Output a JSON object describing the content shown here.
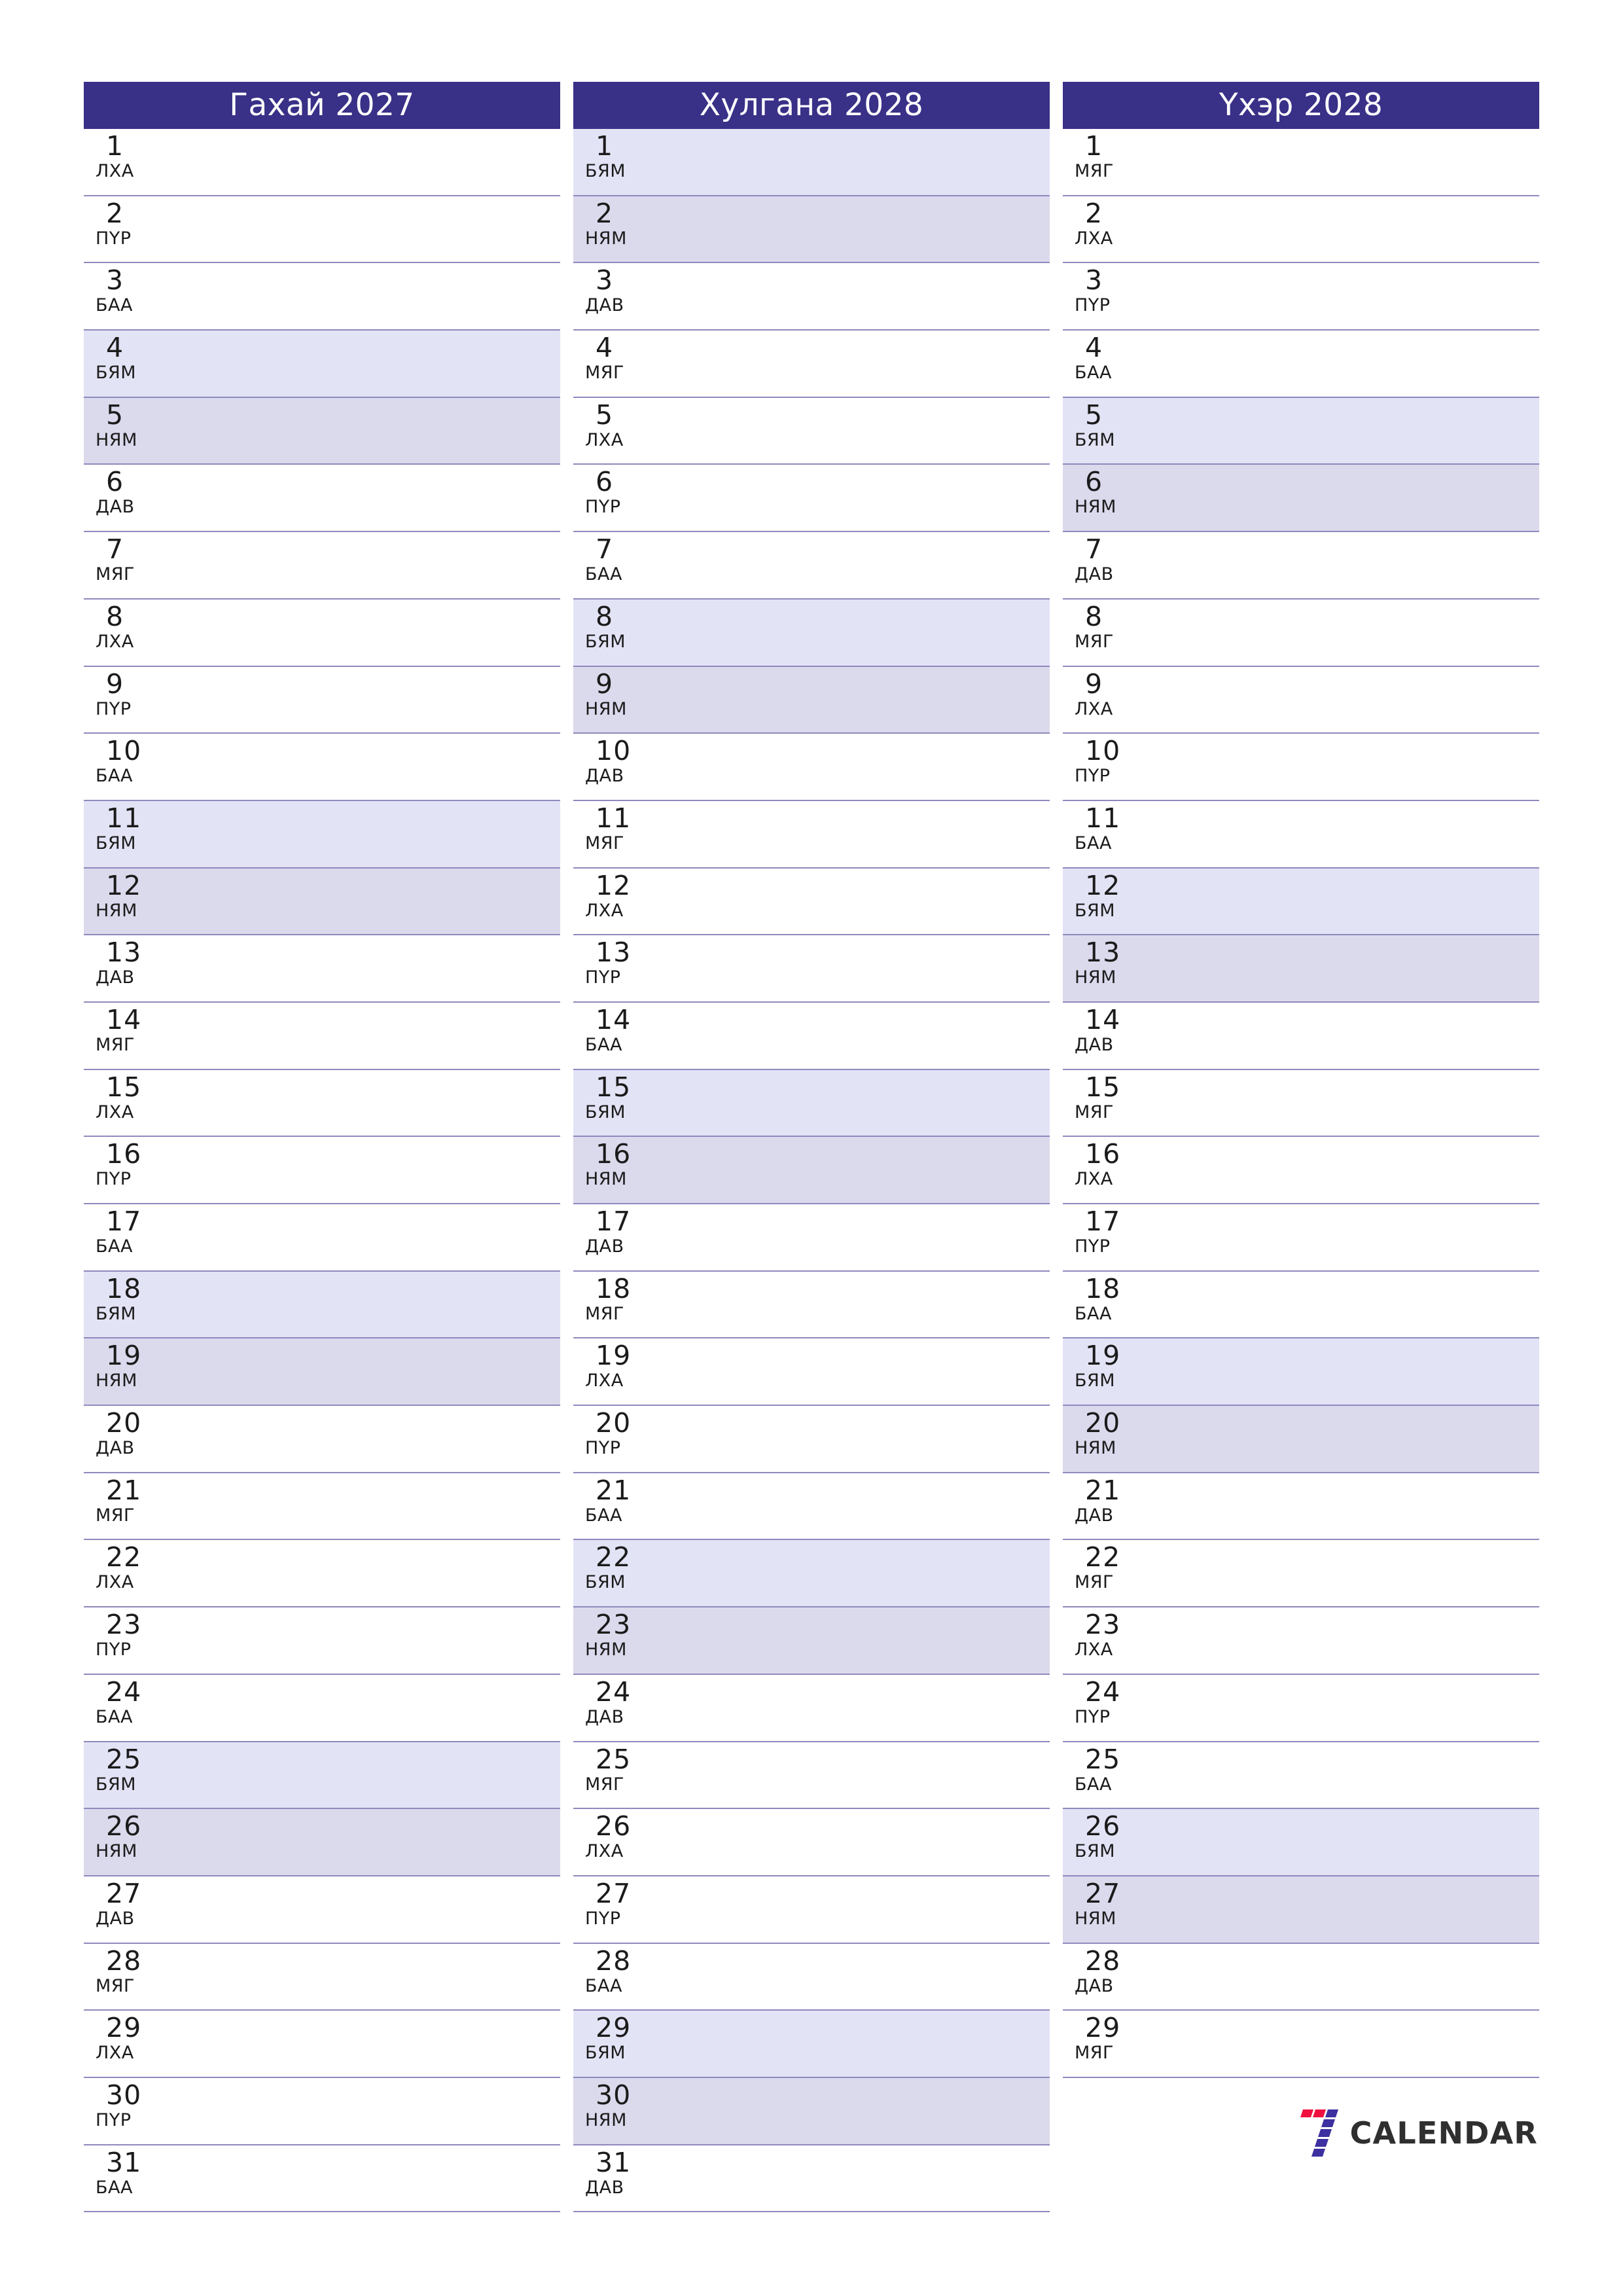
{
  "theme": {
    "header_bg": "#393087",
    "header_text": "#ffffff",
    "saturday_bg": "#e3e3f6",
    "sunday_bg": "#dbd9ec",
    "row_divider": "#8e89bd",
    "page_bg": "#ffffff",
    "day_text": "#1b1b1b",
    "logo_red": "#f0103f",
    "logo_purple": "#3d30a0",
    "logo_text": "#2f2f2f"
  },
  "brand": {
    "mark": "seven-logo-icon",
    "name": "CALENDAR"
  },
  "weekday_abbr": {
    "mon": "ДАВ",
    "tue": "МЯГ",
    "wed": "ЛХА",
    "thu": "ПҮР",
    "fri": "БАА",
    "sat": "БЯМ",
    "sun": "НЯМ"
  },
  "months": [
    {
      "title": "Гахай 2027",
      "days": [
        {
          "n": "1",
          "w": "ЛХА",
          "t": "wd"
        },
        {
          "n": "2",
          "w": "ПҮР",
          "t": "wd"
        },
        {
          "n": "3",
          "w": "БАА",
          "t": "wd"
        },
        {
          "n": "4",
          "w": "БЯМ",
          "t": "sat"
        },
        {
          "n": "5",
          "w": "НЯМ",
          "t": "sun"
        },
        {
          "n": "6",
          "w": "ДАВ",
          "t": "wd"
        },
        {
          "n": "7",
          "w": "МЯГ",
          "t": "wd"
        },
        {
          "n": "8",
          "w": "ЛХА",
          "t": "wd"
        },
        {
          "n": "9",
          "w": "ПҮР",
          "t": "wd"
        },
        {
          "n": "10",
          "w": "БАА",
          "t": "wd"
        },
        {
          "n": "11",
          "w": "БЯМ",
          "t": "sat"
        },
        {
          "n": "12",
          "w": "НЯМ",
          "t": "sun"
        },
        {
          "n": "13",
          "w": "ДАВ",
          "t": "wd"
        },
        {
          "n": "14",
          "w": "МЯГ",
          "t": "wd"
        },
        {
          "n": "15",
          "w": "ЛХА",
          "t": "wd"
        },
        {
          "n": "16",
          "w": "ПҮР",
          "t": "wd"
        },
        {
          "n": "17",
          "w": "БАА",
          "t": "wd"
        },
        {
          "n": "18",
          "w": "БЯМ",
          "t": "sat"
        },
        {
          "n": "19",
          "w": "НЯМ",
          "t": "sun"
        },
        {
          "n": "20",
          "w": "ДАВ",
          "t": "wd"
        },
        {
          "n": "21",
          "w": "МЯГ",
          "t": "wd"
        },
        {
          "n": "22",
          "w": "ЛХА",
          "t": "wd"
        },
        {
          "n": "23",
          "w": "ПҮР",
          "t": "wd"
        },
        {
          "n": "24",
          "w": "БАА",
          "t": "wd"
        },
        {
          "n": "25",
          "w": "БЯМ",
          "t": "sat"
        },
        {
          "n": "26",
          "w": "НЯМ",
          "t": "sun"
        },
        {
          "n": "27",
          "w": "ДАВ",
          "t": "wd"
        },
        {
          "n": "28",
          "w": "МЯГ",
          "t": "wd"
        },
        {
          "n": "29",
          "w": "ЛХА",
          "t": "wd"
        },
        {
          "n": "30",
          "w": "ПҮР",
          "t": "wd"
        },
        {
          "n": "31",
          "w": "БАА",
          "t": "wd"
        }
      ],
      "has_logo": false
    },
    {
      "title": "Хулгана 2028",
      "days": [
        {
          "n": "1",
          "w": "БЯМ",
          "t": "sat"
        },
        {
          "n": "2",
          "w": "НЯМ",
          "t": "sun"
        },
        {
          "n": "3",
          "w": "ДАВ",
          "t": "wd"
        },
        {
          "n": "4",
          "w": "МЯГ",
          "t": "wd"
        },
        {
          "n": "5",
          "w": "ЛХА",
          "t": "wd"
        },
        {
          "n": "6",
          "w": "ПҮР",
          "t": "wd"
        },
        {
          "n": "7",
          "w": "БАА",
          "t": "wd"
        },
        {
          "n": "8",
          "w": "БЯМ",
          "t": "sat"
        },
        {
          "n": "9",
          "w": "НЯМ",
          "t": "sun"
        },
        {
          "n": "10",
          "w": "ДАВ",
          "t": "wd"
        },
        {
          "n": "11",
          "w": "МЯГ",
          "t": "wd"
        },
        {
          "n": "12",
          "w": "ЛХА",
          "t": "wd"
        },
        {
          "n": "13",
          "w": "ПҮР",
          "t": "wd"
        },
        {
          "n": "14",
          "w": "БАА",
          "t": "wd"
        },
        {
          "n": "15",
          "w": "БЯМ",
          "t": "sat"
        },
        {
          "n": "16",
          "w": "НЯМ",
          "t": "sun"
        },
        {
          "n": "17",
          "w": "ДАВ",
          "t": "wd"
        },
        {
          "n": "18",
          "w": "МЯГ",
          "t": "wd"
        },
        {
          "n": "19",
          "w": "ЛХА",
          "t": "wd"
        },
        {
          "n": "20",
          "w": "ПҮР",
          "t": "wd"
        },
        {
          "n": "21",
          "w": "БАА",
          "t": "wd"
        },
        {
          "n": "22",
          "w": "БЯМ",
          "t": "sat"
        },
        {
          "n": "23",
          "w": "НЯМ",
          "t": "sun"
        },
        {
          "n": "24",
          "w": "ДАВ",
          "t": "wd"
        },
        {
          "n": "25",
          "w": "МЯГ",
          "t": "wd"
        },
        {
          "n": "26",
          "w": "ЛХА",
          "t": "wd"
        },
        {
          "n": "27",
          "w": "ПҮР",
          "t": "wd"
        },
        {
          "n": "28",
          "w": "БАА",
          "t": "wd"
        },
        {
          "n": "29",
          "w": "БЯМ",
          "t": "sat"
        },
        {
          "n": "30",
          "w": "НЯМ",
          "t": "sun"
        },
        {
          "n": "31",
          "w": "ДАВ",
          "t": "wd"
        }
      ],
      "has_logo": false
    },
    {
      "title": "Үхэр 2028",
      "days": [
        {
          "n": "1",
          "w": "МЯГ",
          "t": "wd"
        },
        {
          "n": "2",
          "w": "ЛХА",
          "t": "wd"
        },
        {
          "n": "3",
          "w": "ПҮР",
          "t": "wd"
        },
        {
          "n": "4",
          "w": "БАА",
          "t": "wd"
        },
        {
          "n": "5",
          "w": "БЯМ",
          "t": "sat"
        },
        {
          "n": "6",
          "w": "НЯМ",
          "t": "sun"
        },
        {
          "n": "7",
          "w": "ДАВ",
          "t": "wd"
        },
        {
          "n": "8",
          "w": "МЯГ",
          "t": "wd"
        },
        {
          "n": "9",
          "w": "ЛХА",
          "t": "wd"
        },
        {
          "n": "10",
          "w": "ПҮР",
          "t": "wd"
        },
        {
          "n": "11",
          "w": "БАА",
          "t": "wd"
        },
        {
          "n": "12",
          "w": "БЯМ",
          "t": "sat"
        },
        {
          "n": "13",
          "w": "НЯМ",
          "t": "sun"
        },
        {
          "n": "14",
          "w": "ДАВ",
          "t": "wd"
        },
        {
          "n": "15",
          "w": "МЯГ",
          "t": "wd"
        },
        {
          "n": "16",
          "w": "ЛХА",
          "t": "wd"
        },
        {
          "n": "17",
          "w": "ПҮР",
          "t": "wd"
        },
        {
          "n": "18",
          "w": "БАА",
          "t": "wd"
        },
        {
          "n": "19",
          "w": "БЯМ",
          "t": "sat"
        },
        {
          "n": "20",
          "w": "НЯМ",
          "t": "sun"
        },
        {
          "n": "21",
          "w": "ДАВ",
          "t": "wd"
        },
        {
          "n": "22",
          "w": "МЯГ",
          "t": "wd"
        },
        {
          "n": "23",
          "w": "ЛХА",
          "t": "wd"
        },
        {
          "n": "24",
          "w": "ПҮР",
          "t": "wd"
        },
        {
          "n": "25",
          "w": "БАА",
          "t": "wd"
        },
        {
          "n": "26",
          "w": "БЯМ",
          "t": "sat"
        },
        {
          "n": "27",
          "w": "НЯМ",
          "t": "sun"
        },
        {
          "n": "28",
          "w": "ДАВ",
          "t": "wd"
        },
        {
          "n": "29",
          "w": "МЯГ",
          "t": "wd"
        }
      ],
      "has_logo": true
    }
  ]
}
